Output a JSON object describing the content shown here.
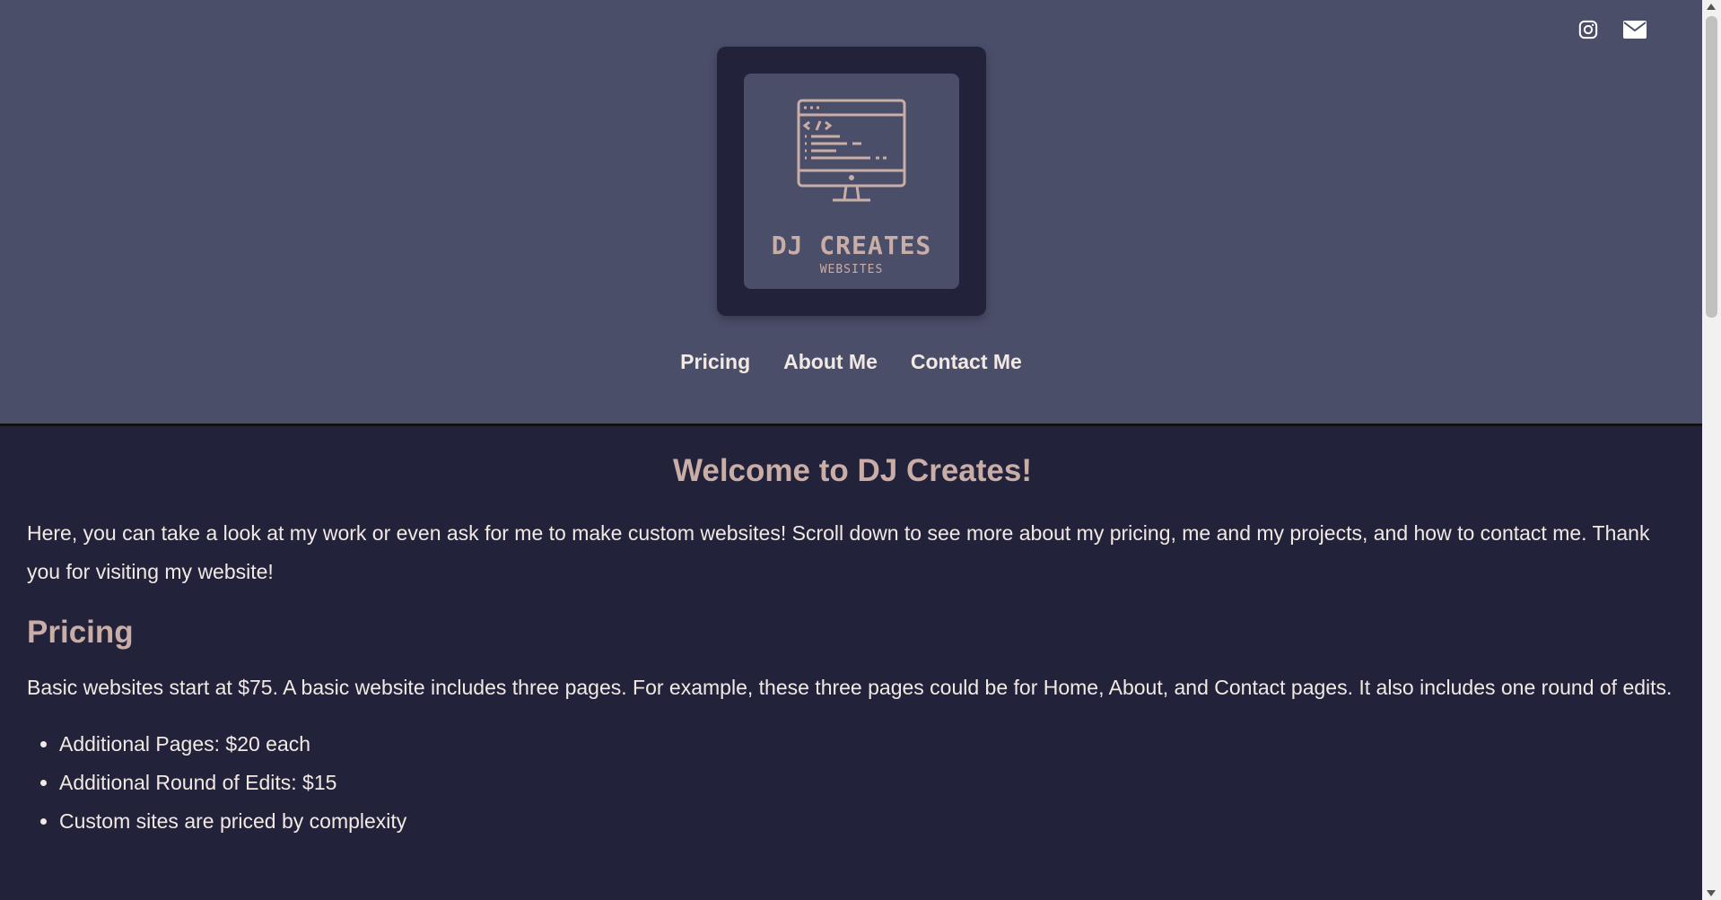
{
  "header": {
    "social": [
      {
        "icon": "instagram-icon"
      },
      {
        "icon": "mail-icon"
      }
    ],
    "logo": {
      "title": "DJ CREATES",
      "subtitle": "WEBSITES",
      "icon": "computer-code-icon"
    },
    "nav": [
      {
        "label": "Pricing"
      },
      {
        "label": "About Me"
      },
      {
        "label": "Contact Me"
      }
    ]
  },
  "main": {
    "welcome_title": "Welcome to DJ Creates!",
    "intro": "Here, you can take a look at my work or even ask for me to make custom websites! Scroll down to see more about my pricing, me and my projects, and how to contact me. Thank you for visiting my website!",
    "pricing_title": "Pricing",
    "pricing_text": "Basic websites start at $75. A basic website includes three pages. For example, these three pages could be for Home, About, and Contact pages. It also includes one round of edits.",
    "pricing_items": [
      "Additional Pages: $20 each",
      "Additional Round of Edits: $15",
      "Custom sites are priced by complexity"
    ]
  },
  "colors": {
    "header_bg": "#4a4e69",
    "page_bg": "#22223b",
    "accent": "#c9ada7",
    "text": "#f2e9e4"
  }
}
